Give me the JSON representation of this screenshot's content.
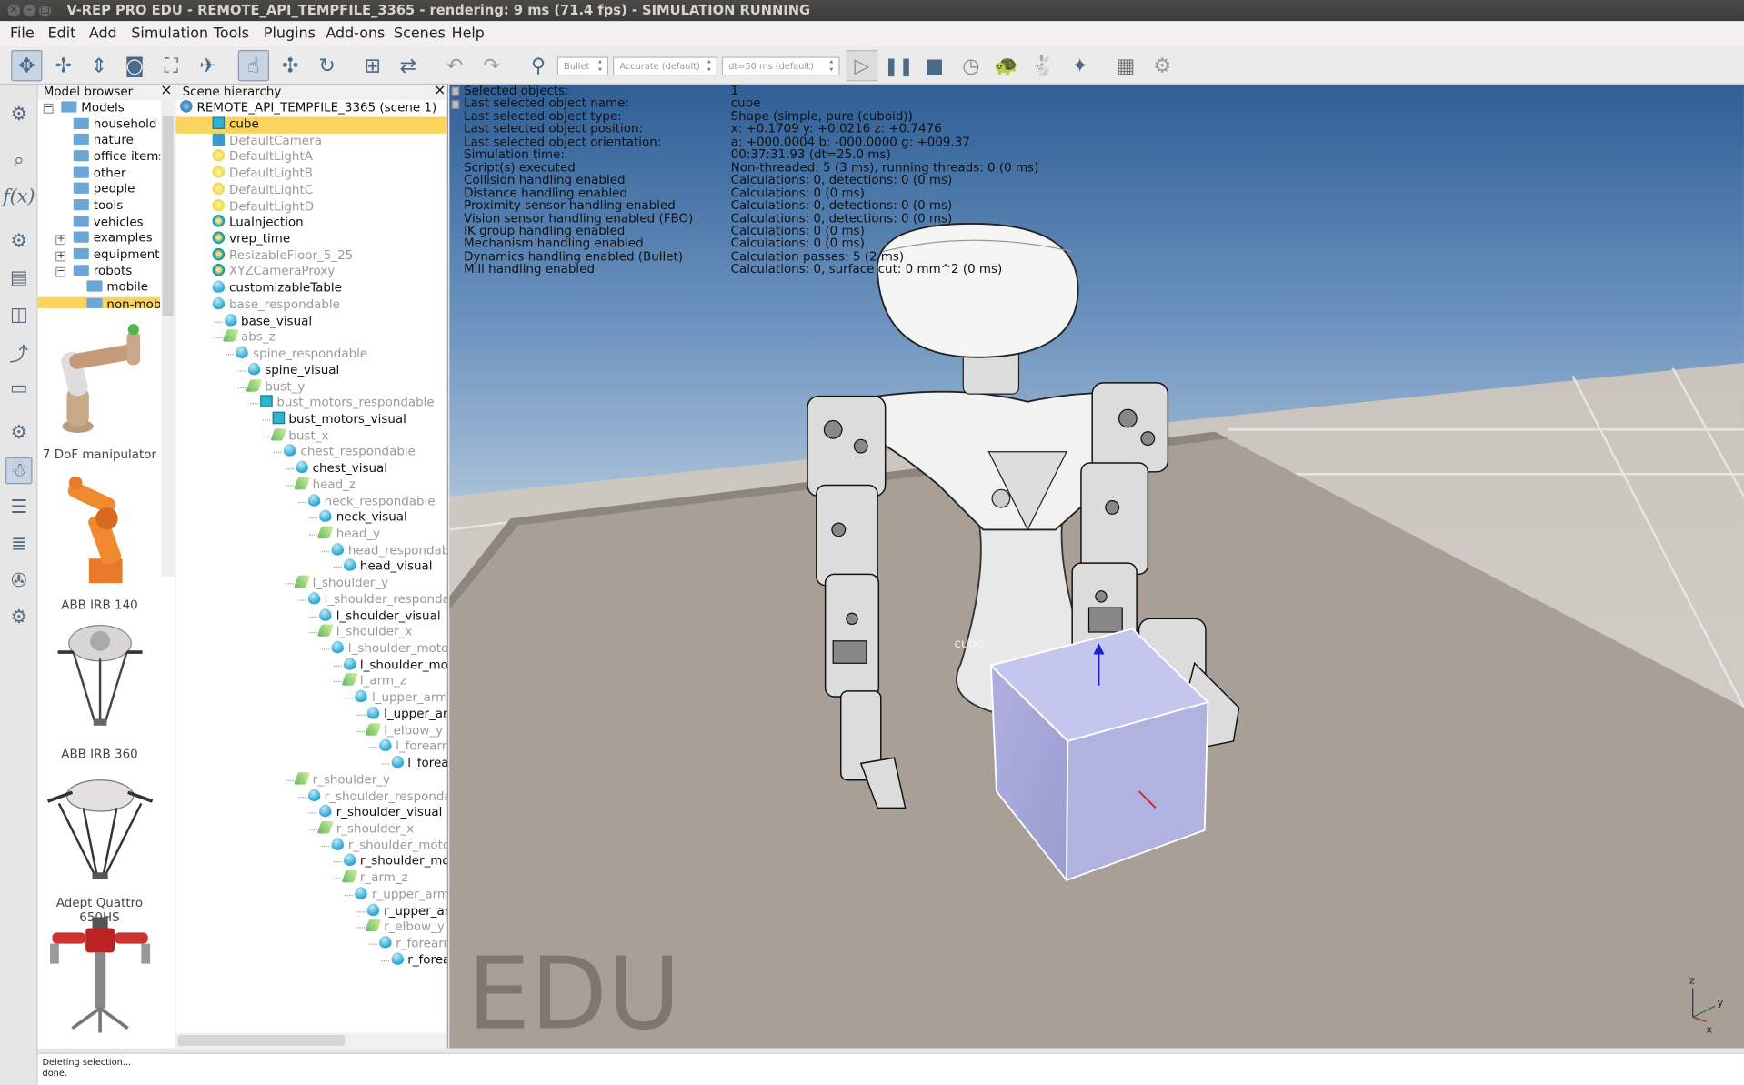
{
  "window": {
    "title": "V-REP PRO EDU - REMOTE_API_TEMPFILE_3365 - rendering: 9 ms (71.4 fps) - SIMULATION RUNNING",
    "buttons": [
      "×",
      "–",
      "□"
    ]
  },
  "menu": [
    "File",
    "Edit",
    "Add",
    "Simulation",
    "Tools",
    "Plugins",
    "Add-ons",
    "Scenes",
    "Help"
  ],
  "toolbar": {
    "engine": "Bullet",
    "accuracy": "Accurate (default)",
    "timestep": "dt=50 ms (default)"
  },
  "model_browser": {
    "title": "Model browser",
    "close": "×",
    "folders": [
      "Models",
      "household",
      "nature",
      "office items",
      "other",
      "people",
      "tools",
      "vehicles",
      "examples",
      "equipment",
      "robots",
      "mobile",
      "non-mob..."
    ],
    "thumbnails": [
      "7 DoF manipulator",
      "ABB IRB 140",
      "ABB IRB 360",
      "Adept Quattro 650HS",
      ""
    ]
  },
  "scene_hierarchy": {
    "title": "Scene hierarchy",
    "close": "×",
    "scene": "REMOTE_API_TEMPFILE_3365 (scene 1)",
    "items": [
      {
        "label": "cube",
        "icon": "cuboid-icon",
        "level": 0
      },
      {
        "label": "DefaultCamera",
        "icon": "camera-icon",
        "level": 0
      },
      {
        "label": "DefaultLightA",
        "icon": "light-icon",
        "level": 0
      },
      {
        "label": "DefaultLightB",
        "icon": "light-icon",
        "level": 0
      },
      {
        "label": "DefaultLightC",
        "icon": "light-icon",
        "level": 0
      },
      {
        "label": "DefaultLightD",
        "icon": "light-icon",
        "level": 0
      },
      {
        "label": "LuaInjection",
        "icon": "script-icon",
        "level": 0
      },
      {
        "label": "vrep_time",
        "icon": "script-icon",
        "level": 0
      },
      {
        "label": "ResizableFloor_5_25",
        "icon": "script-icon",
        "level": 0
      },
      {
        "label": "XYZCameraProxy",
        "icon": "script-icon",
        "level": 0
      },
      {
        "label": "customizableTable",
        "icon": "shape-icon",
        "level": 0
      },
      {
        "label": "base_respondable",
        "icon": "shape-icon",
        "level": 0
      },
      {
        "label": "base_visual",
        "icon": "shape-icon",
        "level": 1
      },
      {
        "label": "abs_z",
        "icon": "joint-icon",
        "level": 1
      },
      {
        "label": "spine_respondable",
        "icon": "shape-icon",
        "level": 2
      },
      {
        "label": "spine_visual",
        "icon": "shape-icon",
        "level": 3
      },
      {
        "label": "bust_y",
        "icon": "joint-icon",
        "level": 3
      },
      {
        "label": "bust_motors_respondable",
        "icon": "cuboid-icon",
        "level": 4
      },
      {
        "label": "bust_motors_visual",
        "icon": "cuboid-icon",
        "level": 5
      },
      {
        "label": "bust_x",
        "icon": "joint-icon",
        "level": 5
      },
      {
        "label": "chest_respondable",
        "icon": "shape-icon",
        "level": 6
      },
      {
        "label": "chest_visual",
        "icon": "shape-icon",
        "level": 7
      },
      {
        "label": "head_z",
        "icon": "joint-icon",
        "level": 7
      },
      {
        "label": "neck_respondable",
        "icon": "shape-icon",
        "level": 8
      },
      {
        "label": "neck_visual",
        "icon": "shape-icon",
        "level": 9
      },
      {
        "label": "head_y",
        "icon": "joint-icon",
        "level": 9
      },
      {
        "label": "head_respondab",
        "icon": "shape-icon",
        "level": 10
      },
      {
        "label": "head_visual",
        "icon": "shape-icon",
        "level": 11
      },
      {
        "label": "l_shoulder_y",
        "icon": "joint-icon",
        "level": 7
      },
      {
        "label": "l_shoulder_respondab",
        "icon": "shape-icon",
        "level": 8
      },
      {
        "label": "l_shoulder_visual",
        "icon": "shape-icon",
        "level": 9
      },
      {
        "label": "l_shoulder_x",
        "icon": "joint-icon",
        "level": 9
      },
      {
        "label": "l_shoulder_motor_",
        "icon": "shape-icon",
        "level": 10
      },
      {
        "label": "l_shoulder_mot",
        "icon": "shape-icon",
        "level": 11
      },
      {
        "label": "l_arm_z",
        "icon": "joint-icon",
        "level": 11
      },
      {
        "label": "l_upper_arm_",
        "icon": "shape-icon",
        "level": 12
      },
      {
        "label": "l_upper_ar",
        "icon": "shape-icon",
        "level": 13
      },
      {
        "label": "l_elbow_y",
        "icon": "joint-icon",
        "level": 13
      },
      {
        "label": "l_forearm",
        "icon": "shape-icon",
        "level": 14
      },
      {
        "label": "l_forea",
        "icon": "shape-icon",
        "level": 15
      },
      {
        "label": "r_shoulder_y",
        "icon": "joint-icon",
        "level": 7
      },
      {
        "label": "r_shoulder_respondab",
        "icon": "shape-icon",
        "level": 8
      },
      {
        "label": "r_shoulder_visual",
        "icon": "shape-icon",
        "level": 9
      },
      {
        "label": "r_shoulder_x",
        "icon": "joint-icon",
        "level": 9
      },
      {
        "label": "r_shoulder_motor",
        "icon": "shape-icon",
        "level": 10
      },
      {
        "label": "r_shoulder_mot",
        "icon": "shape-icon",
        "level": 11
      },
      {
        "label": "r_arm_z",
        "icon": "joint-icon",
        "level": 11
      },
      {
        "label": "r_upper_arm_",
        "icon": "shape-icon",
        "level": 12
      },
      {
        "label": "r_upper_ar",
        "icon": "shape-icon",
        "level": 13
      },
      {
        "label": "r_elbow_y",
        "icon": "joint-icon",
        "level": 13
      },
      {
        "label": "r_forearm",
        "icon": "shape-icon",
        "level": 14
      },
      {
        "label": "r_forea",
        "icon": "shape-icon",
        "level": 15
      }
    ]
  },
  "info_overlay": [
    [
      "Selected objects:",
      "1"
    ],
    [
      "Last selected object name:",
      "cube"
    ],
    [
      "Last selected object type:",
      "Shape (simple, pure (cuboid))"
    ],
    [
      "Last selected object position:",
      "x: +0.1709    y: +0.0216    z: +0.7476"
    ],
    [
      "Last selected object orientation:",
      "a: +000.0004    b: -000.0000    g: +009.37"
    ],
    [
      "Simulation time:",
      "00:37:31.93 (dt=25.0 ms)"
    ],
    [
      "Script(s) executed",
      "Non-threaded: 5 (3 ms), running threads: 0 (0 ms)"
    ],
    [
      "Collision handling enabled",
      "Calculations: 0, detections: 0 (0 ms)"
    ],
    [
      "Distance handling enabled",
      "Calculations: 0 (0 ms)"
    ],
    [
      "Proximity sensor handling enabled",
      "Calculations: 0, detections: 0 (0 ms)"
    ],
    [
      "Vision sensor handling enabled (FBO)",
      "Calculations: 0, detections: 0 (0 ms)"
    ],
    [
      "IK group handling enabled",
      "Calculations: 0 (0 ms)"
    ],
    [
      "Mechanism handling enabled",
      "Calculations: 0 (0 ms)"
    ],
    [
      "Dynamics handling enabled (Bullet)",
      "Calculation passes: 5 (2 ms)"
    ],
    [
      "Mill handling enabled",
      "Calculations: 0, surface cut: 0 mm^2 (0 ms)"
    ]
  ],
  "scene": {
    "watermark": "EDU",
    "cube_label": "cube",
    "axis_labels": [
      "z",
      "x",
      "y"
    ]
  },
  "status": [
    "Deleting selection...",
    "done."
  ],
  "colors": {
    "selection": "#fcd35c",
    "sky_top": "#2f5f96",
    "table": "#a39a91",
    "cube": "#b0b2e0"
  }
}
